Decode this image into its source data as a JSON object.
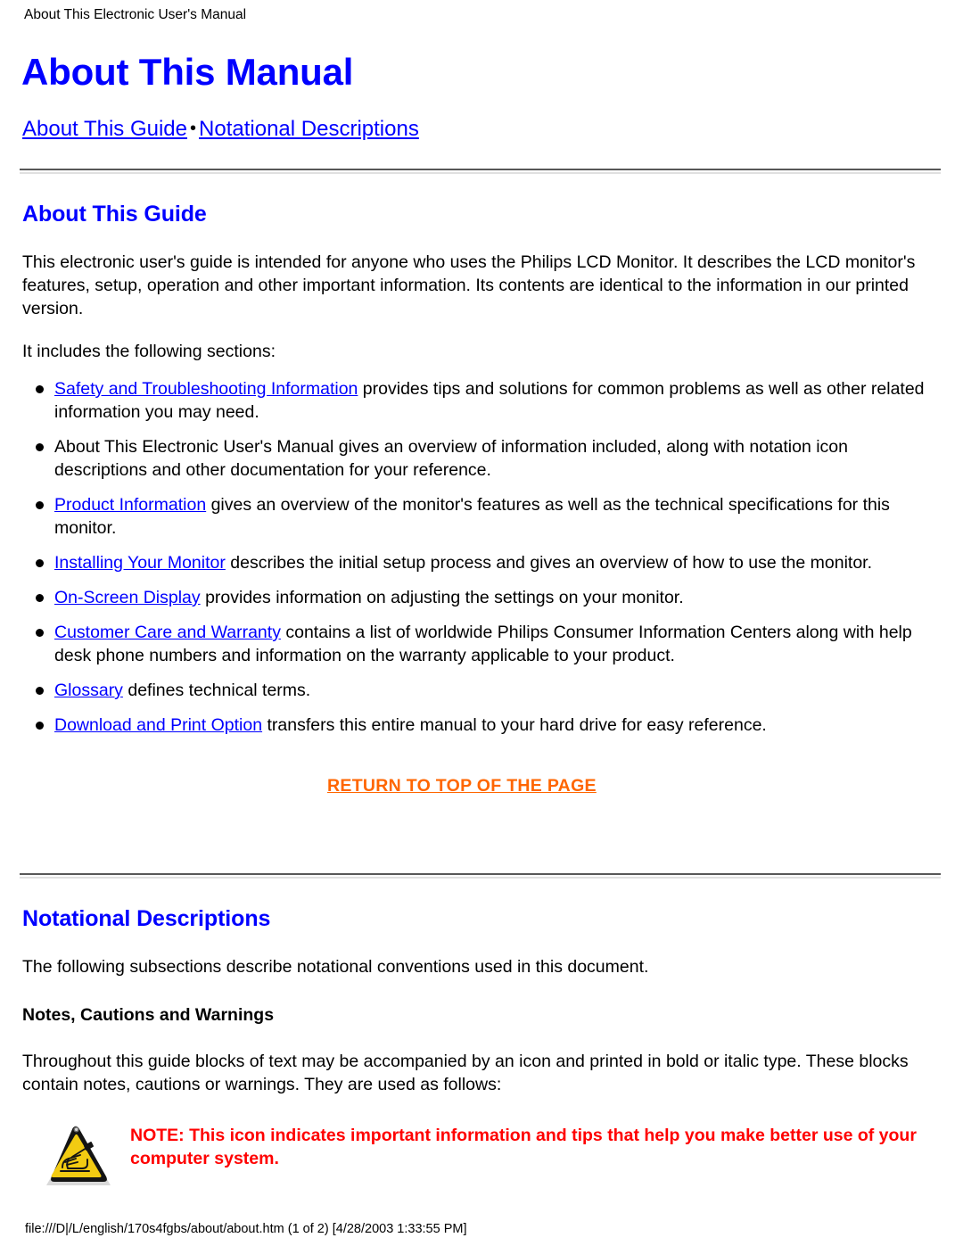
{
  "running_header": "About This Electronic User's Manual",
  "title": "About This Manual",
  "nav": {
    "link1": "About This Guide",
    "separator": "•",
    "link2": "Notational Descriptions"
  },
  "sections": {
    "about_guide": {
      "heading": "About This Guide",
      "intro": "This electronic user's guide is intended for anyone who uses the Philips LCD Monitor. It describes the LCD monitor's features, setup, operation and other important information. Its contents are identical to the information in our printed version.",
      "includes_label": "It includes the following sections:",
      "items": [
        {
          "link": "Safety and Troubleshooting Information",
          "text": " provides tips and solutions for common problems as well as other related information you may need."
        },
        {
          "link": "",
          "text": "About This Electronic User's Manual gives an overview of information included, along with notation icon descriptions and other documentation for your reference."
        },
        {
          "link": "Product Information",
          "text": " gives an overview of the monitor's features as well as the technical specifications for this monitor."
        },
        {
          "link": "Installing Your Monitor",
          "text": " describes the initial setup process and gives an overview of how to use the monitor."
        },
        {
          "link": "On-Screen Display",
          "text": " provides information on adjusting the settings on your monitor."
        },
        {
          "link": "Customer Care and Warranty",
          "text": " contains a list of worldwide Philips Consumer Information Centers along with help desk phone numbers and information on the warranty applicable to your product."
        },
        {
          "link": "Glossary",
          "text": " defines technical terms."
        },
        {
          "link": "Download and Print Option",
          "text": " transfers this entire manual to your hard drive for easy reference."
        }
      ],
      "return_to_top": "RETURN TO TOP OF THE PAGE"
    },
    "notational": {
      "heading": "Notational Descriptions",
      "intro": "The following subsections describe notational conventions used in this document.",
      "subheading": "Notes, Cautions and Warnings",
      "body": "Throughout this guide blocks of text may be accompanied by an icon and printed in bold or italic type. These blocks contain notes, cautions or warnings. They are used as follows:",
      "note": {
        "icon": "warning-triangle-icon",
        "text": "NOTE: This icon indicates important information and tips that help you make better use of your computer system."
      }
    }
  },
  "footer": "file:///D|/L/english/170s4fgbs/about/about.htm (1 of 2) [4/28/2003 1:33:55 PM]",
  "colors": {
    "heading_blue": "#0000ff",
    "link_blue": "#0000ff",
    "return_orange": "#ff6600",
    "note_red": "#ff0000",
    "rule_dark": "#585858",
    "rule_light": "#e0e0e0",
    "icon_yellow": "#f5d015",
    "icon_border": "#1a1a1a"
  }
}
